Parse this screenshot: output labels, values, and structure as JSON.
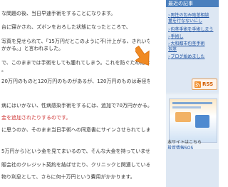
{
  "article": {
    "lines": [
      {
        "text": "な問題の後、当日早速手術をすることになります。",
        "color": "normal"
      },
      {
        "text": "台に寝かされ、ズボンをおろした状態になったところで、",
        "color": "normal"
      },
      {
        "text": "写真を見せられて、「15万円だとこのように不(汁上がる、きれいな仕上がりに",
        "color": "normal"
      },
      {
        "text": "かかる。」と言われました。",
        "color": "normal"
      },
      {
        "text": "で、このままでは手術をしても腫れてしまう。これを防ぐためにはコラーゲ",
        "color": "normal"
      },
      {
        "text": "。",
        "color": "normal"
      },
      {
        "text": "20万円のものと120万円のものがあるが、120万円のものは寿径を持て",
        "color": "normal"
      },
      {
        "text": "病にはいかない、性病感染手術をするには、追加で70万円かかる。」とか",
        "color": "normal"
      },
      {
        "text": "金を追加されたりするのです。",
        "color": "red"
      },
      {
        "text": "に思うのか、そのまま当日手術への同意書にサインさせられてしまうことにな",
        "color": "normal"
      },
      {
        "text": "5万円から)という金を見てまいるので、そんな大金を持っていません。",
        "color": "normal"
      },
      {
        "text": "販会社のクレジット契約を結ばせたり、クリニックと関連している貸金業者から",
        "color": "normal"
      },
      {
        "text": "物り利息として、さらに何十万円という費用がかかります。",
        "color": "normal"
      }
    ]
  },
  "sidebar": {
    "recent_header": "最近の記事",
    "recent_links": [
      "男性の包み陰茎相談",
      "量を行なないにし",
      "包茎手術を手術しまう",
      "手術し",
      "大和都市包茎手術",
      "包茎",
      "ブログ始めました"
    ],
    "rss_label": "RSS",
    "banner_caption": "本サイトはこちら",
    "banner_link": "投資情報SOS"
  },
  "colors": {
    "sidebar_header": "#4a7fbd",
    "sidebar_bg": "#dde7f3",
    "rss_orange": "#f08a24",
    "arrow": "#f08a24",
    "red_text": "#cc2b2b"
  }
}
